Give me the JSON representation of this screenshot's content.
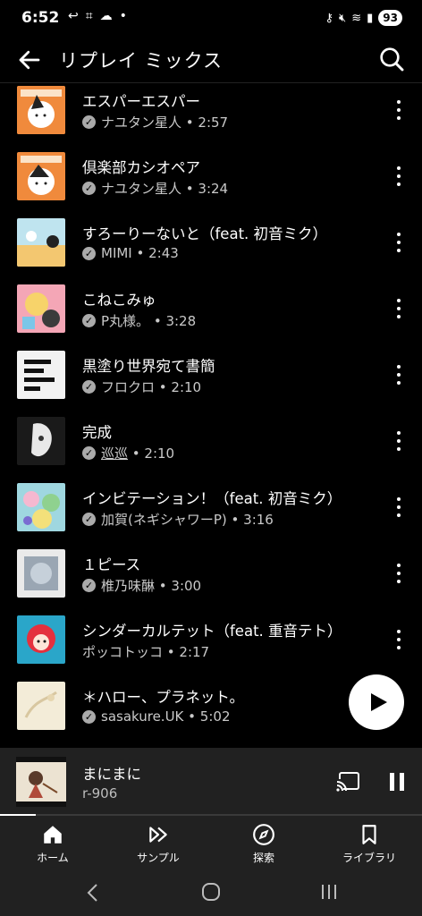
{
  "status_bar": {
    "time": "6:52",
    "battery": "93"
  },
  "header": {
    "title": "リプレイ ミックス"
  },
  "songs": [
    {
      "title": "エスパーエスパー",
      "artist": "ナユタン星人",
      "duration": "2:57"
    },
    {
      "title": "倶楽部カシオペア",
      "artist": "ナユタン星人",
      "duration": "3:24"
    },
    {
      "title": "すろーりーないと（feat. 初音ミク）",
      "artist": "MIMI",
      "duration": "2:43"
    },
    {
      "title": "こねこみゅ",
      "artist": "P丸様。",
      "duration": "3:28"
    },
    {
      "title": "黒塗り世界宛て書簡",
      "artist": "フロクロ",
      "duration": "2:10"
    },
    {
      "title": "完成",
      "artist": "巡巡",
      "duration": "2:10"
    },
    {
      "title": "インビテーション！（feat. 初音ミク）",
      "artist": "加賀(ネギシャワーP)",
      "duration": "3:16"
    },
    {
      "title": "１ピース",
      "artist": "椎乃味醂",
      "duration": "3:00"
    },
    {
      "title": "シンダーカルテット（feat. 重音テト）",
      "artist": "ポッコトッコ",
      "duration": "2:17"
    },
    {
      "title": "＊ハロー、プラネット。",
      "artist": "sasakure.UK",
      "duration": "5:02"
    }
  ],
  "now_playing": {
    "title": "まにまに",
    "artist": "r-906",
    "progress_fraction": 0.085
  },
  "bottom_nav": [
    {
      "label": "ホーム",
      "icon": "home-icon"
    },
    {
      "label": "サンプル",
      "icon": "samples-icon"
    },
    {
      "label": "探索",
      "icon": "explore-icon"
    },
    {
      "label": "ライブラリ",
      "icon": "library-icon"
    }
  ],
  "colors": {
    "background": "#000000",
    "panel": "#212121",
    "muted_text": "#c9c9c9"
  }
}
